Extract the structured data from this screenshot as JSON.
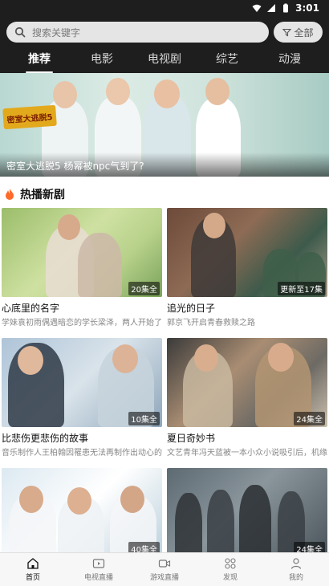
{
  "status_bar": {
    "time": "3:01"
  },
  "search": {
    "placeholder": "搜索关键字",
    "all_label": "全部"
  },
  "tabs": [
    {
      "label": "推荐",
      "active": true
    },
    {
      "label": "电影",
      "active": false
    },
    {
      "label": "电视剧",
      "active": false
    },
    {
      "label": "综艺",
      "active": false
    },
    {
      "label": "动漫",
      "active": false
    }
  ],
  "banner": {
    "logo_text": "密室大逃脱5",
    "caption": "密室大逃脱5 杨幂被npc气到了?"
  },
  "section": {
    "title": "热播新剧"
  },
  "cards": [
    {
      "title": "心底里的名字",
      "desc": "学妹袁初雨偶遇暗恋的学长梁泽，两人开始了",
      "badge": "20集全"
    },
    {
      "title": "追光的日子",
      "desc": "郭京飞开启青春救赎之路",
      "badge": "更新至17集"
    },
    {
      "title": "比悲伤更悲伤的故事",
      "desc": "音乐制作人王柏翰因罹患无法再制作出动心的专",
      "badge": "10集全"
    },
    {
      "title": "夏日奇妙书",
      "desc": "文艺青年冯天蓝被一本小众小说吸引后，机缘巧",
      "badge": "24集全"
    },
    {
      "title": "",
      "desc": "",
      "badge": "40集全"
    },
    {
      "title": "",
      "desc": "",
      "badge": "24集全"
    }
  ],
  "bottom_nav": [
    {
      "label": "首页",
      "icon": "home-icon",
      "active": true
    },
    {
      "label": "电视直播",
      "icon": "tv-icon",
      "active": false
    },
    {
      "label": "游戏直播",
      "icon": "video-camera-icon",
      "active": false
    },
    {
      "label": "发现",
      "icon": "discover-grid-icon",
      "active": false
    },
    {
      "label": "我的",
      "icon": "user-icon",
      "active": false
    }
  ],
  "colors": {
    "header_bg": "#1e1e1e",
    "search_bg": "#e5e5e5",
    "accent_flame": "#ff6a2b"
  }
}
